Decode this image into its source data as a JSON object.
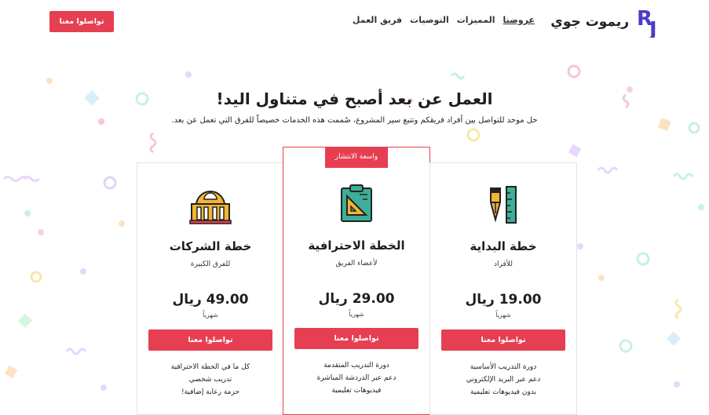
{
  "header": {
    "brand": "ريموت جوي",
    "nav": [
      {
        "label": "عروضنا",
        "active": true
      },
      {
        "label": "المميزات",
        "active": false
      },
      {
        "label": "التوصيات",
        "active": false
      },
      {
        "label": "فريق العمل",
        "active": false
      }
    ],
    "cta_label": "تواصلوا معنا"
  },
  "hero": {
    "title": "العمل عن بعد أصبح في متناول اليد!",
    "subtitle": "حل موحد للتواصل بين أفراد فريقكم وتتبع سير المشروع، صُممت هذه الخدمات خصيصاً للفرق التي تعمل عن بعد."
  },
  "plans": [
    {
      "name": "خطة البداية",
      "audience": "للأفراد",
      "price": "19.00 ريال",
      "period": "شهرياً",
      "cta": "تواصلوا معنا",
      "features": [
        "دورة التدريب الأساسية",
        "دعم عبر البريد الإلكتروني",
        "بدون فيديوهات تعليمية"
      ],
      "icon": "pen-ruler-icon"
    },
    {
      "name": "الخطة الاحترافية",
      "audience": "لأعضاء الفريق",
      "price": "29.00 ريال",
      "period": "شهرياً",
      "cta": "تواصلوا معنا",
      "badge": "واسعة الانتشار",
      "features": [
        "دورة التدريب المتقدمة",
        "دعم عبر الدردشة المباشرة",
        "فيديوهات تعليمية"
      ],
      "icon": "clipboard-icon"
    },
    {
      "name": "خطة الشركات",
      "audience": "للفرق الكبيرة",
      "price": "49.00 ريال",
      "period": "شهرياً",
      "cta": "تواصلوا معنا",
      "features": [
        "كل ما في الخطة الاحترافية",
        "تدريب شخصي",
        "حزمة رعاية إضافية!"
      ],
      "icon": "building-icon"
    }
  ],
  "colors": {
    "accent": "#e63f52",
    "logo": "#4b3bc9"
  }
}
